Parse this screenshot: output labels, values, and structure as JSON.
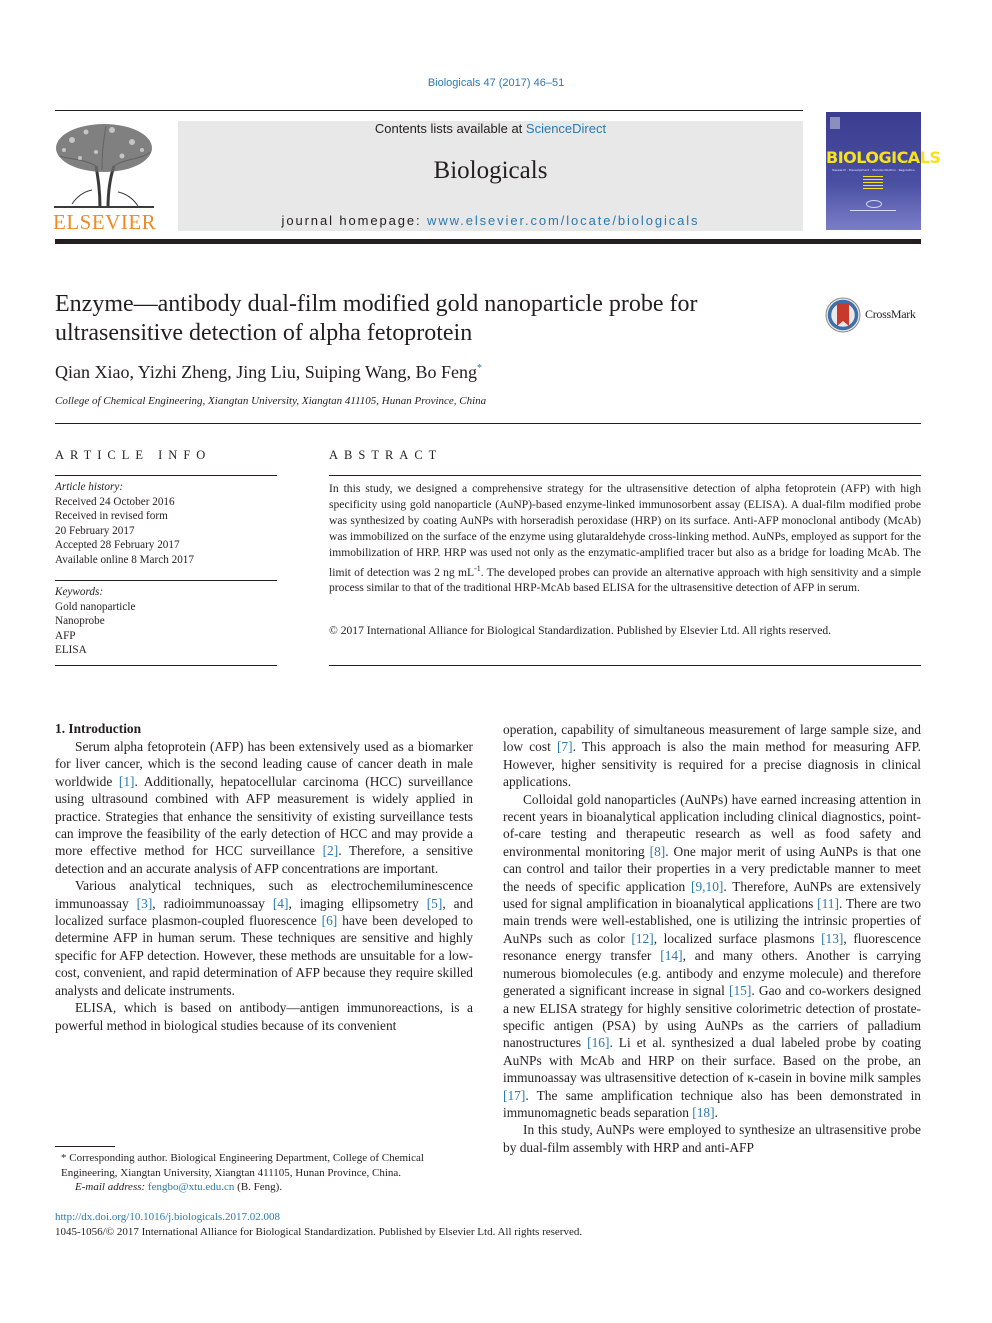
{
  "header": {
    "citation": "Biologicals 47 (2017) 46–51",
    "contents_prefix": "Contents lists available at ",
    "contents_link": "ScienceDirect",
    "journal_name": "Biologicals",
    "homepage_prefix": "journal homepage: ",
    "homepage_link": "www.elsevier.com/locate/biologicals",
    "publisher_logo": "ELSEVIER",
    "cover": {
      "title": "BIOLOGICALS",
      "subtitle": "Research · Development · Standardization · Regulation"
    },
    "colors": {
      "link": "#2a7ab0",
      "elsevier_orange": "#f08a24",
      "masthead_bg": "#e8e8e8",
      "cover_blue": "#3a3d8f",
      "cover_yellow": "#f7e21b"
    }
  },
  "article": {
    "title": "Enzyme—antibody dual-film modified gold nanoparticle probe for ultrasensitive detection of alpha fetoprotein",
    "crossmark_label": "CrossMark",
    "authors": "Qian Xiao, Yizhi Zheng, Jing Liu, Suiping Wang, Bo Feng",
    "author_mark": "*",
    "affiliation": "College of Chemical Engineering, Xiangtan University, Xiangtan 411105, Hunan Province, China"
  },
  "article_info": {
    "heading": "ARTICLE INFO",
    "history_label": "Article history:",
    "history": [
      "Received 24 October 2016",
      "Received in revised form",
      "20 February 2017",
      "Accepted 28 February 2017",
      "Available online 8 March 2017"
    ],
    "keywords_label": "Keywords:",
    "keywords": [
      "Gold nanoparticle",
      "Nanoprobe",
      "AFP",
      "ELISA"
    ]
  },
  "abstract": {
    "heading": "ABSTRACT",
    "text_before_sup": "In this study, we designed a comprehensive strategy for the ultrasensitive detection of alpha fetoprotein (AFP) with high specificity using gold nanoparticle (AuNP)-based enzyme-linked immunosorbent assay (ELISA). A dual-film modified probe was synthesized by coating AuNPs with horseradish peroxidase (HRP) on its surface. Anti-AFP monoclonal antibody (McAb) was immobilized on the surface of the enzyme using glutaraldehyde cross-linking method. AuNPs, employed as support for the immobilization of HRP. HRP was used not only as the enzymatic-amplified tracer but also as a bridge for loading McAb. The limit of detection was 2 ng mL",
    "sup": "-1",
    "text_after_sup": ". The developed probes can provide an alternative approach with high sensitivity and a simple process similar to that of the traditional HRP-McAb based ELISA for the ultrasensitive detection of AFP in serum.",
    "copyright": "© 2017 International Alliance for Biological Standardization. Published by Elsevier Ltd. All rights reserved."
  },
  "body": {
    "section_heading": "1.  Introduction",
    "left_paragraphs": [
      [
        {
          "t": "Serum alpha fetoprotein (AFP) has been extensively used as a biomarker for liver cancer, which is the second leading cause of cancer death in male worldwide "
        },
        {
          "ref": "[1]"
        },
        {
          "t": ". Additionally, hepatocellular carcinoma (HCC) surveillance using ultrasound combined with AFP measurement is widely applied in practice. Strategies that enhance the sensitivity of existing surveillance tests can improve the feasi­bility of the early detection of HCC and may provide a more effec­tive method for HCC surveillance "
        },
        {
          "ref": "[2]"
        },
        {
          "t": ". Therefore, a sensitive detection and an accurate analysis of AFP concentrations are important."
        }
      ],
      [
        {
          "t": "Various analytical techniques, such as electro­chemiluminescence immunoassay "
        },
        {
          "ref": "[3]"
        },
        {
          "t": ", radioimmunoassay "
        },
        {
          "ref": "[4]"
        },
        {
          "t": ", im­aging ellipsometry "
        },
        {
          "ref": "[5]"
        },
        {
          "t": ", and localized surface plasmon-coupled fluorescence "
        },
        {
          "ref": "[6]"
        },
        {
          "t": " have been developed to determine AFP in human serum. These techniques are sensitive and highly specific for AFP detection. However, these methods are unsuitable for a low-cost, convenient, and rapid determination of AFP because they require skilled analysts and delicate instruments."
        }
      ],
      [
        {
          "t": "ELISA, which is based on antibody—antigen immunoreactions, is a powerful method in biological studies because of its convenient"
        }
      ]
    ],
    "right_paragraphs": [
      [
        {
          "t": "operation, capability of simultaneous measurement of large sample size, and low cost "
        },
        {
          "ref": "[7]"
        },
        {
          "t": ". This approach is also the main method for measuring AFP. However, higher sensitivity is required for a precise diagnosis in clinical applications."
        }
      ],
      [
        {
          "t": "Colloidal gold nanoparticles (AuNPs) have earned increasing attention in recent years in bioanalytical application including clinical diagnostics, point-of-care testing and therapeutic research as well as food safety and environmental monitoring "
        },
        {
          "ref": "[8]"
        },
        {
          "t": ". One major merit of using AuNPs is that one can control and tailor their properties in a very predictable manner to meet the needs of spe­cific application "
        },
        {
          "ref": "[9,10]"
        },
        {
          "t": ". Therefore, AuNPs are extensively used for signal amplification in bioanalytical applications "
        },
        {
          "ref": "[11]"
        },
        {
          "t": ". There are two main trends were well-established, one is utilizing the intrinsic properties of AuNPs such as color "
        },
        {
          "ref": "[12]"
        },
        {
          "t": ", localized surface plasmons "
        },
        {
          "ref": "[13]"
        },
        {
          "t": ", fluorescence resonance energy transfer "
        },
        {
          "ref": "[14]"
        },
        {
          "t": ", and many others. Another is carrying numerous biomolecules (e.g. antibody and enzyme molecule) and therefore generated a significant increase in signal "
        },
        {
          "ref": "[15]"
        },
        {
          "t": ". Gao and co-workers designed a new ELISA strategy for highly sensitive colorimetric detection of prostate-specific antigen (PSA) by using AuNPs as the carriers of palladium nanostructures "
        },
        {
          "ref": "[16]"
        },
        {
          "t": ". Li et al. synthesized a dual labeled probe by coating AuNPs with McAb and HRP on their surface. Based on the probe, an immunoassay was ultrasensitive detection of κ-casein in bovine milk samples "
        },
        {
          "ref": "[17]"
        },
        {
          "t": ". The same amplification technique also has been demonstrated in immunomagnetic beads separation "
        },
        {
          "ref": "[18]"
        },
        {
          "t": "."
        }
      ],
      [
        {
          "t": "In this study, AuNPs were employed to synthesize an ultrasen­sitive probe by dual-film assembly with HRP and anti-AFP"
        }
      ]
    ]
  },
  "footnote": {
    "corresponding": "* Corresponding author. Biological Engineering Department, College of Chemical Engineering, Xiangtan University, Xiangtan 411105, Hunan Province, China.",
    "email_label": "E-mail address: ",
    "email": "fengbo@xtu.edu.cn",
    "email_suffix": " (B. Feng)."
  },
  "footer": {
    "doi": "http://dx.doi.org/10.1016/j.biologicals.2017.02.008",
    "issn_line": "1045-1056/© 2017 International Alliance for Biological Standardization. Published by Elsevier Ltd. All rights reserved."
  }
}
